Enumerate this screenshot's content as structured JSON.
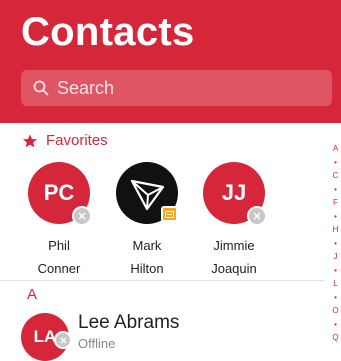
{
  "header": {
    "title": "Contacts",
    "search_placeholder": "Search"
  },
  "favorites": {
    "label": "Favorites",
    "items": [
      {
        "initials": "PC",
        "first": "Phil",
        "last": "Conner",
        "status": "offline"
      },
      {
        "initials": "",
        "first": "Mark",
        "last": "Hilton",
        "status": "away",
        "avatar_icon": "triangle-logo-icon"
      },
      {
        "initials": "JJ",
        "first": "Jimmie",
        "last": "Joaquin",
        "status": "offline"
      }
    ]
  },
  "sections": [
    {
      "letter": "A",
      "contacts": [
        {
          "initials": "LA",
          "name": "Lee Abrams",
          "status": "Offline"
        }
      ]
    }
  ],
  "index_bar": [
    "A",
    "•",
    "C",
    "•",
    "F",
    "•",
    "H",
    "•",
    "J",
    "•",
    "L",
    "•",
    "O",
    "•",
    "Q"
  ],
  "colors": {
    "accent": "#d6273a",
    "search_bg": "#e05564",
    "status_offline": "#c7c7c7",
    "status_away": "#f5a623"
  }
}
